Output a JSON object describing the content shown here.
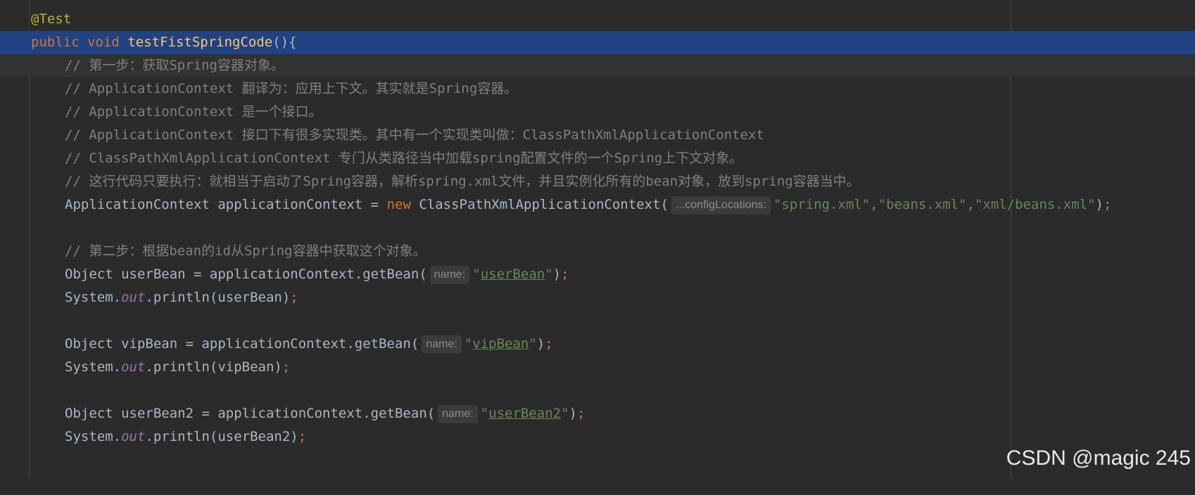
{
  "editor": {
    "line1": {
      "annotation": "@Test"
    },
    "line2": {
      "kw_public": "public",
      "kw_void": "void",
      "method_name": "testFistSpringCode",
      "rest": "(){"
    },
    "line3": {
      "comment": "// 第一步：获取Spring容器对象。"
    },
    "line4": {
      "comment": "// ApplicationContext 翻译为：应用上下文。其实就是Spring容器。"
    },
    "line5": {
      "comment": "// ApplicationContext 是一个接口。"
    },
    "line6": {
      "comment": "// ApplicationContext 接口下有很多实现类。其中有一个实现类叫做：ClassPathXmlApplicationContext"
    },
    "line7": {
      "comment": "// ClassPathXmlApplicationContext 专门从类路径当中加载spring配置文件的一个Spring上下文对象。"
    },
    "line8": {
      "comment": "// 这行代码只要执行：就相当于启动了Spring容器，解析spring.xml文件，并且实例化所有的bean对象，放到spring容器当中。"
    },
    "line9": {
      "part1": "ApplicationContext applicationContext = ",
      "kw_new": "new",
      "part2": " ClassPathXmlApplicationContext(",
      "hint": "...configLocations:",
      "str1": "\"spring.xml\"",
      "comma1": ",",
      "str2": "\"beans.xml\"",
      "comma2": ",",
      "str3": "\"xml/beans.xml\"",
      "close": ")",
      "semi": ";"
    },
    "line11": {
      "comment": "// 第二步：根据bean的id从Spring容器中获取这个对象。"
    },
    "line12": {
      "part1": "Object userBean = applicationContext.getBean(",
      "hint": "name:",
      "q_open": "\"",
      "str": "userBean",
      "q_close": "\"",
      "close": ")",
      "semi": ";"
    },
    "line13": {
      "part1": "System.",
      "static_field": "out",
      "part2": ".println(userBean)",
      "semi": ";"
    },
    "line15": {
      "part1": "Object vipBean = applicationContext.getBean(",
      "hint": "name:",
      "q_open": "\"",
      "str": "vipBean",
      "q_close": "\"",
      "close": ")",
      "semi": ";"
    },
    "line16": {
      "part1": "System.",
      "static_field": "out",
      "part2": ".println(vipBean)",
      "semi": ";"
    },
    "line18": {
      "part1": "Object userBean2 = applicationContext.getBean(",
      "hint": "name:",
      "q_open": "\"",
      "str": "userBean2",
      "q_close": "\"",
      "close": ")",
      "semi": ";"
    },
    "line19": {
      "part1": "System.",
      "static_field": "out",
      "part2": ".println(userBean2)",
      "semi": ";"
    }
  },
  "watermark": "CSDN @magic 245",
  "colors": {
    "background": "#2b2b2b",
    "selection": "#214283",
    "keyword": "#cc7832",
    "method": "#ffc66d",
    "comment": "#808080",
    "string": "#6a8759",
    "annotation": "#bbb529",
    "static_field": "#9876aa",
    "text": "#a9b7c6"
  }
}
